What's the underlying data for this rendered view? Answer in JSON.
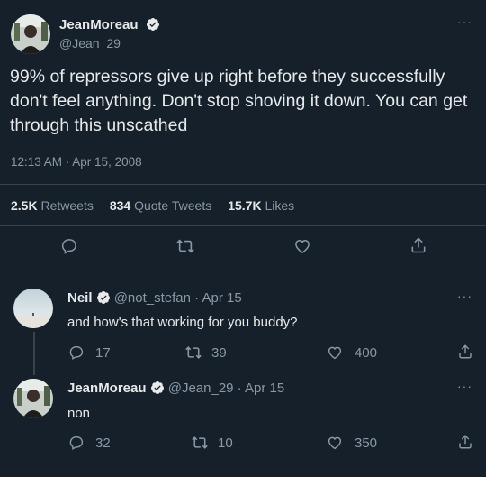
{
  "main_tweet": {
    "author_name": "JeanMoreau",
    "author_handle": "@Jean_29",
    "text": "99% of repressors give up right before they successfully don't feel anything. Don't stop shoving it down. You can get through this unscathed",
    "timestamp": "12:13 AM · Apr 15, 2008",
    "stats": {
      "retweets_count": "2.5K",
      "retweets_label": "Retweets",
      "quotes_count": "834",
      "quotes_label": "Quote Tweets",
      "likes_count": "15.7K",
      "likes_label": "Likes"
    }
  },
  "replies": [
    {
      "author_name": "Neil",
      "author_handle": "@not_stefan",
      "date": "· Apr 15",
      "text": "and how's that working for you buddy?",
      "replies": "17",
      "retweets": "39",
      "likes": "400"
    },
    {
      "author_name": "JeanMoreau",
      "author_handle": "@Jean_29",
      "date": "· Apr 15",
      "text": "non",
      "replies": "32",
      "retweets": "10",
      "likes": "350"
    }
  ],
  "more_icon": "···",
  "colors": {
    "background": "#15202b",
    "text": "#e7e9ea",
    "muted": "#8b98a5",
    "divider": "#38444d"
  },
  "icons": [
    "verified-badge-icon",
    "reply-icon",
    "retweet-icon",
    "like-icon",
    "share-icon",
    "more-icon"
  ]
}
